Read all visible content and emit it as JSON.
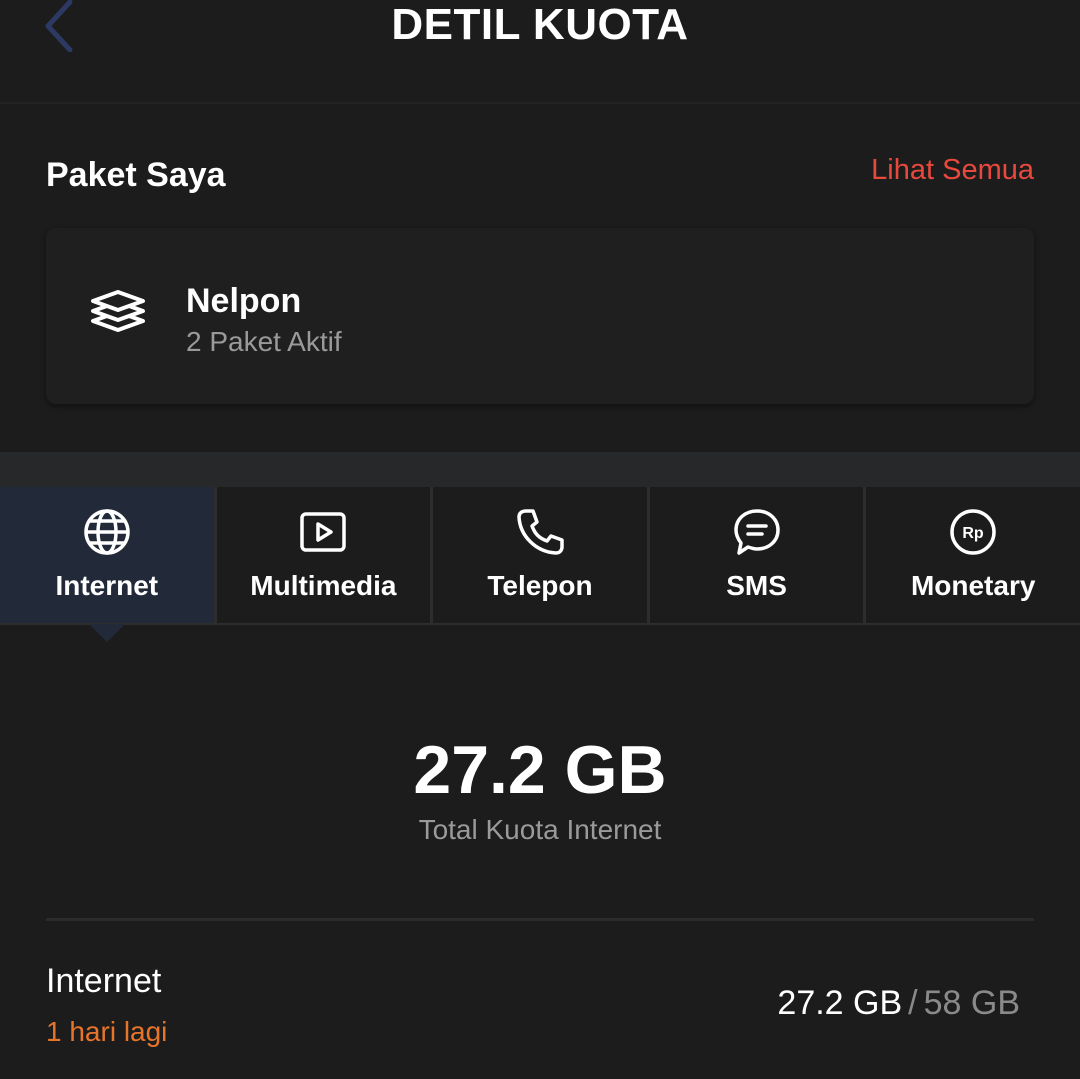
{
  "header": {
    "title": "DETIL KUOTA"
  },
  "my_packages": {
    "title": "Paket Saya",
    "see_all_label": "Lihat Semua",
    "card": {
      "name": "Nelpon",
      "subtitle": "2 Paket Aktif",
      "icon": "layers-icon"
    }
  },
  "tabs": [
    {
      "label": "Internet",
      "icon": "globe-icon",
      "active": true
    },
    {
      "label": "Multimedia",
      "icon": "play-icon",
      "active": false
    },
    {
      "label": "Telepon",
      "icon": "phone-icon",
      "active": false
    },
    {
      "label": "SMS",
      "icon": "chat-icon",
      "active": false
    },
    {
      "label": "Monetary",
      "icon": "rupiah-icon",
      "active": false
    }
  ],
  "summary": {
    "total_value": "27.2 GB",
    "total_label": "Total Kuota Internet"
  },
  "quota_items": [
    {
      "name": "Internet",
      "remaining_days": "1 hari lagi",
      "used": "27.2 GB",
      "separator": "/",
      "capacity": "58 GB"
    }
  ],
  "colors": {
    "accent_red": "#e9483c",
    "accent_orange": "#e8742a",
    "active_tab": "#222a3a",
    "background": "#1c1c1c"
  }
}
